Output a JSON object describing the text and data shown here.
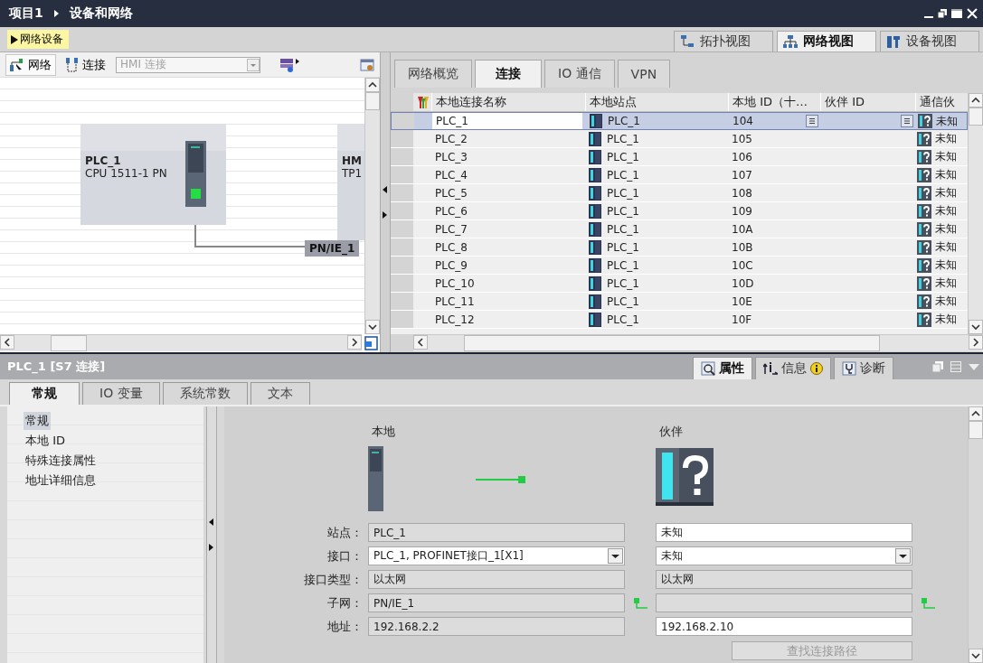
{
  "window": {
    "breadcrumb": [
      "项目1",
      "设备和网络"
    ]
  },
  "editor_button": {
    "label": "网络设备"
  },
  "view_tabs": [
    {
      "label": "拓扑视图",
      "selected": false
    },
    {
      "label": "网络视图",
      "selected": true
    },
    {
      "label": "设备视图",
      "selected": false
    }
  ],
  "network_toolbar": {
    "network_button": "网络",
    "connections_button": "连接",
    "connection_type": {
      "value": "HMI 连接",
      "disabled": true
    }
  },
  "devices": [
    {
      "kind": "plc",
      "name": "PLC_1",
      "type": "CPU 1511-1 PN"
    },
    {
      "kind": "hmi",
      "name": "HM",
      "type": "TP1"
    }
  ],
  "subnet": {
    "label": "PN/IE_1"
  },
  "table_tabs": [
    {
      "label": "网络概览",
      "selected": false
    },
    {
      "label": "连接",
      "selected": true
    },
    {
      "label": "IO 通信",
      "selected": false
    },
    {
      "label": "VPN",
      "selected": false
    }
  ],
  "table": {
    "columns": [
      "本地连接名称",
      "本地站点",
      "本地 ID（十…",
      "伙伴 ID",
      "通信伙"
    ],
    "rows": [
      {
        "name": "PLC_1",
        "station": "PLC_1",
        "local_id": "104",
        "partner": "未知",
        "selected": true
      },
      {
        "name": "PLC_2",
        "station": "PLC_1",
        "local_id": "105",
        "partner": "未知",
        "selected": false
      },
      {
        "name": "PLC_3",
        "station": "PLC_1",
        "local_id": "106",
        "partner": "未知",
        "selected": false
      },
      {
        "name": "PLC_4",
        "station": "PLC_1",
        "local_id": "107",
        "partner": "未知",
        "selected": false
      },
      {
        "name": "PLC_5",
        "station": "PLC_1",
        "local_id": "108",
        "partner": "未知",
        "selected": false
      },
      {
        "name": "PLC_6",
        "station": "PLC_1",
        "local_id": "109",
        "partner": "未知",
        "selected": false
      },
      {
        "name": "PLC_7",
        "station": "PLC_1",
        "local_id": "10A",
        "partner": "未知",
        "selected": false
      },
      {
        "name": "PLC_8",
        "station": "PLC_1",
        "local_id": "10B",
        "partner": "未知",
        "selected": false
      },
      {
        "name": "PLC_9",
        "station": "PLC_1",
        "local_id": "10C",
        "partner": "未知",
        "selected": false
      },
      {
        "name": "PLC_10",
        "station": "PLC_1",
        "local_id": "10D",
        "partner": "未知",
        "selected": false
      },
      {
        "name": "PLC_11",
        "station": "PLC_1",
        "local_id": "10E",
        "partner": "未知",
        "selected": false
      },
      {
        "name": "PLC_12",
        "station": "PLC_1",
        "local_id": "10F",
        "partner": "未知",
        "selected": false
      }
    ]
  },
  "inspector": {
    "title": "PLC_1 [S7 连接]",
    "tabs": [
      {
        "label": "属性",
        "selected": true
      },
      {
        "label": "信息",
        "selected": false
      },
      {
        "label": "诊断",
        "selected": false
      }
    ]
  },
  "property_tabs": [
    {
      "label": "常规",
      "selected": true
    },
    {
      "label": "IO 变量",
      "selected": false
    },
    {
      "label": "系统常数",
      "selected": false
    },
    {
      "label": "文本",
      "selected": false
    }
  ],
  "property_nav": [
    {
      "label": "常规",
      "selected": true
    },
    {
      "label": "本地 ID",
      "selected": false
    },
    {
      "label": "特殊连接属性",
      "selected": false
    },
    {
      "label": "地址详细信息",
      "selected": false
    }
  ],
  "connection_form": {
    "local_header": "本地",
    "partner_header": "伙伴",
    "fields": [
      {
        "label": "站点：",
        "local": {
          "value": "PLC_1",
          "kind": "readonly"
        },
        "partner": {
          "value": "未知",
          "kind": "input"
        },
        "link": false
      },
      {
        "label": "接口：",
        "local": {
          "value": "PLC_1, PROFINET接口_1[X1]",
          "kind": "dropdown"
        },
        "partner": {
          "value": "未知",
          "kind": "dropdown"
        },
        "link": false
      },
      {
        "label": "接口类型：",
        "local": {
          "value": "以太网",
          "kind": "readonly"
        },
        "partner": {
          "value": "以太网",
          "kind": "readonly"
        },
        "link": false
      },
      {
        "label": "子网：",
        "local": {
          "value": "PN/IE_1",
          "kind": "readonly"
        },
        "partner": {
          "kind": "readonly"
        },
        "link": true
      },
      {
        "label": "地址：",
        "local": {
          "value": "192.168.2.2",
          "kind": "readonly"
        },
        "partner": {
          "value": "192.168.2.10",
          "kind": "input"
        },
        "link": false
      }
    ],
    "find_path_button": {
      "label": "查找连接路径",
      "disabled": true
    }
  }
}
